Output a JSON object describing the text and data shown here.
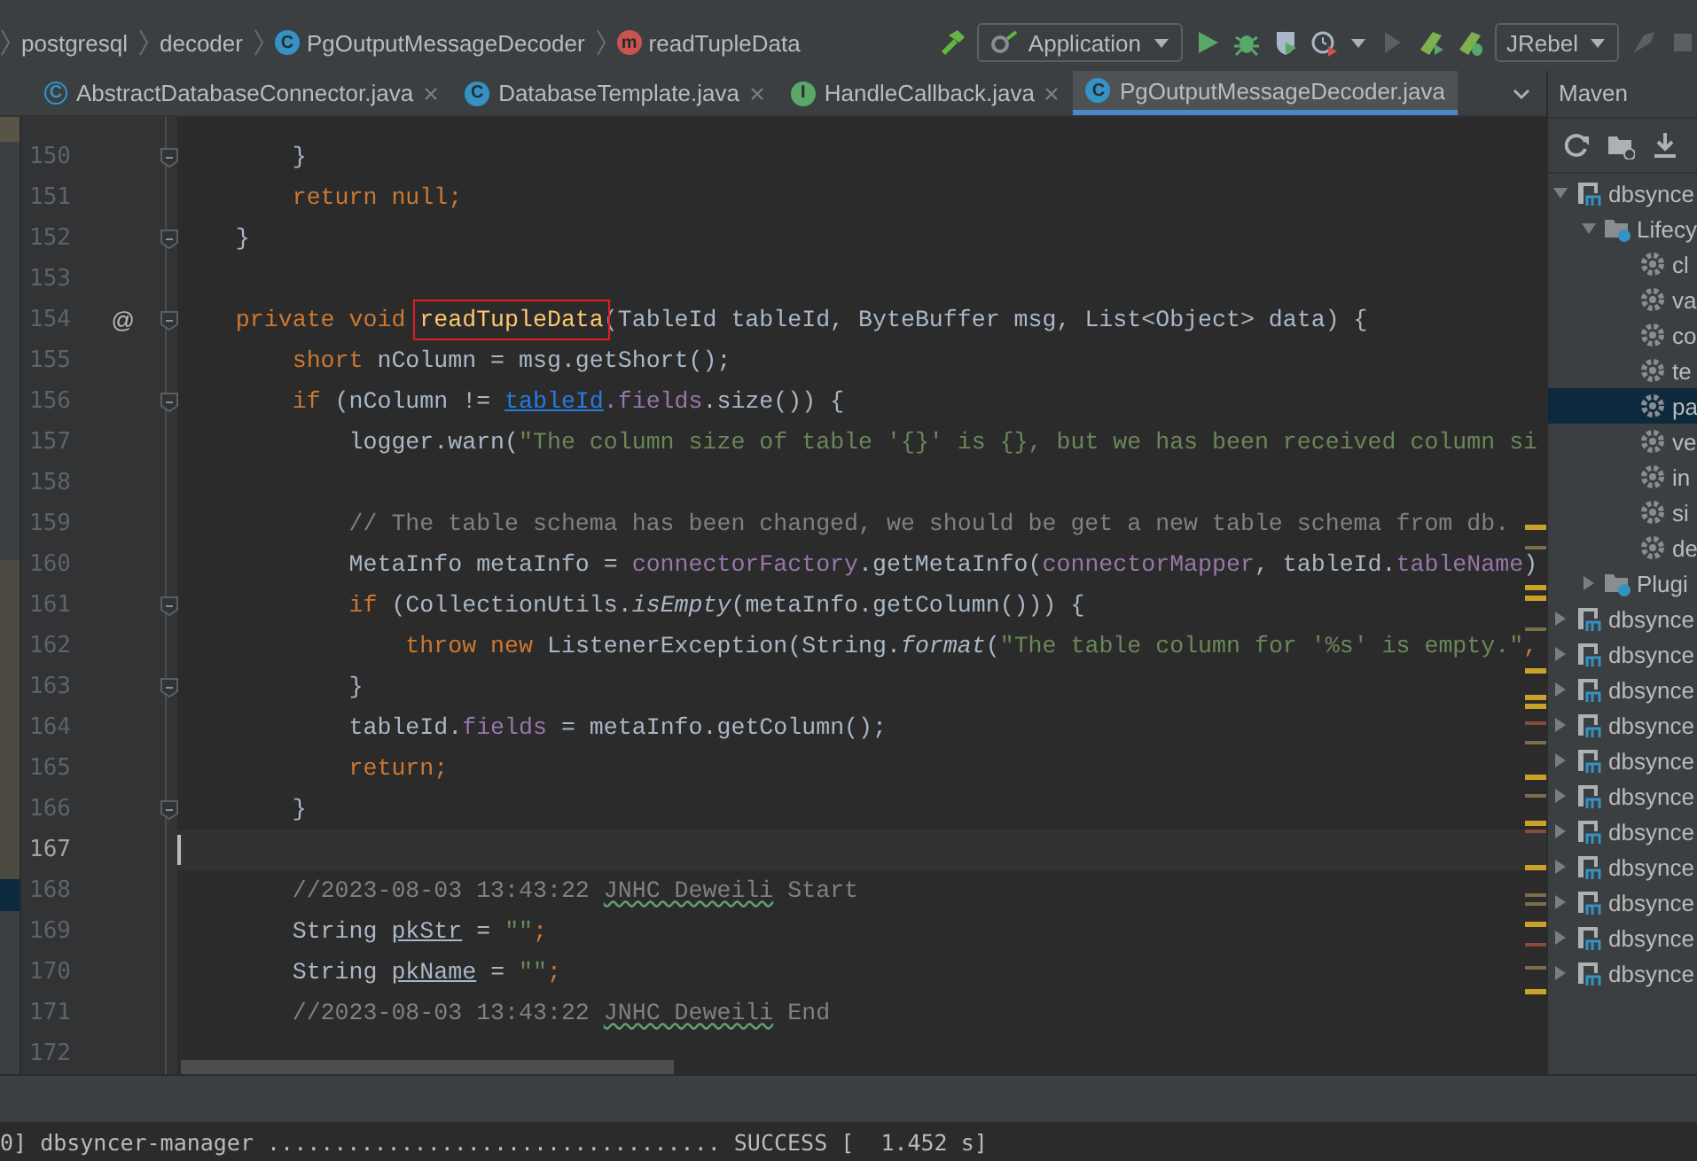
{
  "breadcrumbs": [
    {
      "label": "postgresql"
    },
    {
      "label": "decoder"
    },
    {
      "label": "PgOutputMessageDecoder",
      "kind": "class",
      "icon_letter": "C"
    },
    {
      "label": "readTupleData",
      "kind": "method",
      "icon_letter": "m"
    }
  ],
  "toolbar": {
    "run_config": "Application",
    "plugin_select": "JRebel"
  },
  "tabs": [
    {
      "label": "AbstractDatabaseConnector.java",
      "kind": "abstract-class",
      "icon_letter": "C",
      "selected": false,
      "closable": true
    },
    {
      "label": "DatabaseTemplate.java",
      "kind": "class",
      "icon_letter": "C",
      "selected": false,
      "closable": true
    },
    {
      "label": "HandleCallback.java",
      "kind": "interface",
      "icon_letter": "I",
      "selected": false,
      "closable": true
    },
    {
      "label": "PgOutputMessageDecoder.java",
      "kind": "class",
      "icon_letter": "C",
      "selected": true,
      "closable": false
    }
  ],
  "editor": {
    "lines": [
      {
        "number": "150",
        "fold": true,
        "current": false,
        "tokens": [
          {
            "text": "        }",
            "kind": "plain"
          }
        ]
      },
      {
        "number": "151",
        "fold": false,
        "current": false,
        "tokens": [
          {
            "text": "        return null;",
            "kind": "kw"
          }
        ]
      },
      {
        "number": "152",
        "fold": true,
        "current": false,
        "tokens": [
          {
            "text": "    }",
            "kind": "plain"
          }
        ]
      },
      {
        "number": "153",
        "fold": false,
        "current": false
      },
      {
        "number": "154",
        "fold": true,
        "current": false,
        "annotation": "@",
        "tokens": [
          {
            "text": "    private void ",
            "kind": "kw"
          },
          {
            "text": "readTupleData",
            "kind": "decl",
            "boxed": true
          },
          {
            "text": "(TableId tableId, ByteBuffer msg, List<Object> data) {",
            "kind": "plain"
          }
        ]
      },
      {
        "number": "155",
        "fold": false,
        "current": false,
        "tokens": [
          {
            "text": "        short",
            "kind": "kw"
          },
          {
            "text": " nColumn = msg.getShort();",
            "kind": "plain"
          }
        ]
      },
      {
        "number": "156",
        "fold": true,
        "current": false,
        "tokens": [
          {
            "text": "        if",
            "kind": "kw"
          },
          {
            "text": " (nColumn != ",
            "kind": "plain"
          },
          {
            "text": "tableId",
            "kind": "ref"
          },
          {
            "text": ".fields",
            "kind": "field"
          },
          {
            "text": ".size()) {",
            "kind": "plain"
          }
        ]
      },
      {
        "number": "157",
        "fold": false,
        "current": false,
        "tokens": [
          {
            "text": "            logger.warn(",
            "kind": "plain"
          },
          {
            "text": "\"The column size of table '{}' is {}, but we has been received column si",
            "kind": "str"
          }
        ]
      },
      {
        "number": "158",
        "fold": false,
        "current": false
      },
      {
        "number": "159",
        "fold": false,
        "current": false,
        "tokens": [
          {
            "text": "            // The table schema has been changed, we should be get a new table schema from db.",
            "kind": "comment"
          }
        ]
      },
      {
        "number": "160",
        "fold": false,
        "current": false,
        "tokens": [
          {
            "text": "            MetaInfo metaInfo = ",
            "kind": "plain"
          },
          {
            "text": "connectorFactory",
            "kind": "field"
          },
          {
            "text": ".getMetaInfo(",
            "kind": "plain"
          },
          {
            "text": "connectorMapper",
            "kind": "field"
          },
          {
            "text": ", tableId.",
            "kind": "plain"
          },
          {
            "text": "tableName",
            "kind": "field"
          },
          {
            "text": ")",
            "kind": "plain"
          }
        ]
      },
      {
        "number": "161",
        "fold": true,
        "current": false,
        "tokens": [
          {
            "text": "            if",
            "kind": "kw"
          },
          {
            "text": " (CollectionUtils.",
            "kind": "plain"
          },
          {
            "text": "isEmpty",
            "kind": "static"
          },
          {
            "text": "(metaInfo.getColumn())) {",
            "kind": "plain"
          }
        ]
      },
      {
        "number": "162",
        "fold": false,
        "current": false,
        "tokens": [
          {
            "text": "                throw new",
            "kind": "kw"
          },
          {
            "text": " ListenerException(String.",
            "kind": "plain"
          },
          {
            "text": "format",
            "kind": "static"
          },
          {
            "text": "(",
            "kind": "plain"
          },
          {
            "text": "\"The table column for '%s' is empty.\"",
            "kind": "str"
          },
          {
            "text": ",",
            "kind": "kw"
          }
        ]
      },
      {
        "number": "163",
        "fold": true,
        "current": false,
        "tokens": [
          {
            "text": "            }",
            "kind": "plain"
          }
        ]
      },
      {
        "number": "164",
        "fold": false,
        "current": false,
        "tokens": [
          {
            "text": "            tableId.",
            "kind": "plain"
          },
          {
            "text": "fields",
            "kind": "field"
          },
          {
            "text": " = metaInfo.getColumn();",
            "kind": "plain"
          }
        ]
      },
      {
        "number": "165",
        "fold": false,
        "current": false,
        "tokens": [
          {
            "text": "            return;",
            "kind": "kw"
          }
        ]
      },
      {
        "number": "166",
        "fold": true,
        "current": false,
        "tokens": [
          {
            "text": "        }",
            "kind": "plain"
          }
        ]
      },
      {
        "number": "167",
        "fold": false,
        "current": true
      },
      {
        "number": "168",
        "fold": false,
        "current": false,
        "tokens": [
          {
            "text": "        //2023-08-03 13:43:22 ",
            "kind": "comment"
          },
          {
            "text": "JNHC Deweili",
            "kind": "typo"
          },
          {
            "text": " Start",
            "kind": "comment"
          }
        ]
      },
      {
        "number": "169",
        "fold": false,
        "current": false,
        "tokens": [
          {
            "text": "        String ",
            "kind": "plain"
          },
          {
            "text": "pkStr",
            "kind": "unused"
          },
          {
            "text": " = ",
            "kind": "plain"
          },
          {
            "text": "\"\"",
            "kind": "str"
          },
          {
            "text": ";",
            "kind": "kw"
          }
        ]
      },
      {
        "number": "170",
        "fold": false,
        "current": false,
        "tokens": [
          {
            "text": "        String ",
            "kind": "plain"
          },
          {
            "text": "pkName",
            "kind": "unused"
          },
          {
            "text": " = ",
            "kind": "plain"
          },
          {
            "text": "\"\"",
            "kind": "str"
          },
          {
            "text": ";",
            "kind": "kw"
          }
        ]
      },
      {
        "number": "171",
        "fold": false,
        "current": false,
        "tokens": [
          {
            "text": "        //2023-08-03 13:43:22 ",
            "kind": "comment"
          },
          {
            "text": "JNHC Deweili",
            "kind": "typo"
          },
          {
            "text": " End",
            "kind": "comment"
          }
        ]
      },
      {
        "number": "172",
        "fold": false,
        "current": false
      }
    ]
  },
  "maven": {
    "title": "Maven",
    "tree": [
      {
        "label": "dbsynce",
        "kind": "module",
        "expanded": true,
        "selected": false,
        "children": [
          {
            "label": "Lifecy",
            "kind": "folder",
            "expanded": true,
            "selected": false,
            "children": [
              {
                "label": "cl",
                "kind": "goal",
                "selected": false
              },
              {
                "label": "va",
                "kind": "goal",
                "selected": false
              },
              {
                "label": "co",
                "kind": "goal",
                "selected": false
              },
              {
                "label": "te",
                "kind": "goal",
                "selected": false
              },
              {
                "label": "pa",
                "kind": "goal",
                "selected": true
              },
              {
                "label": "ve",
                "kind": "goal",
                "selected": false
              },
              {
                "label": "in",
                "kind": "goal",
                "selected": false
              },
              {
                "label": "si",
                "kind": "goal",
                "selected": false
              },
              {
                "label": "de",
                "kind": "goal",
                "selected": false
              }
            ]
          },
          {
            "label": "Plugi",
            "kind": "folder",
            "expanded": false,
            "selected": false
          }
        ]
      },
      {
        "label": "dbsynce",
        "kind": "module",
        "expanded": false,
        "selected": false
      },
      {
        "label": "dbsynce",
        "kind": "module",
        "expanded": false,
        "selected": false
      },
      {
        "label": "dbsynce",
        "kind": "module",
        "expanded": false,
        "selected": false
      },
      {
        "label": "dbsynce",
        "kind": "module",
        "expanded": false,
        "selected": false
      },
      {
        "label": "dbsynce",
        "kind": "module",
        "expanded": false,
        "selected": false
      },
      {
        "label": "dbsynce",
        "kind": "module",
        "expanded": false,
        "selected": false
      },
      {
        "label": "dbsynce",
        "kind": "module",
        "expanded": false,
        "selected": false
      },
      {
        "label": "dbsynce",
        "kind": "module",
        "expanded": false,
        "selected": false
      },
      {
        "label": "dbsynce",
        "kind": "module",
        "expanded": false,
        "selected": false
      },
      {
        "label": "dbsynce",
        "kind": "module",
        "expanded": false,
        "selected": false
      },
      {
        "label": "dbsynce",
        "kind": "module",
        "expanded": false,
        "selected": false
      }
    ]
  },
  "console": {
    "line": "0] dbsyncer-manager .................................. SUCCESS [  1.452 s]"
  }
}
